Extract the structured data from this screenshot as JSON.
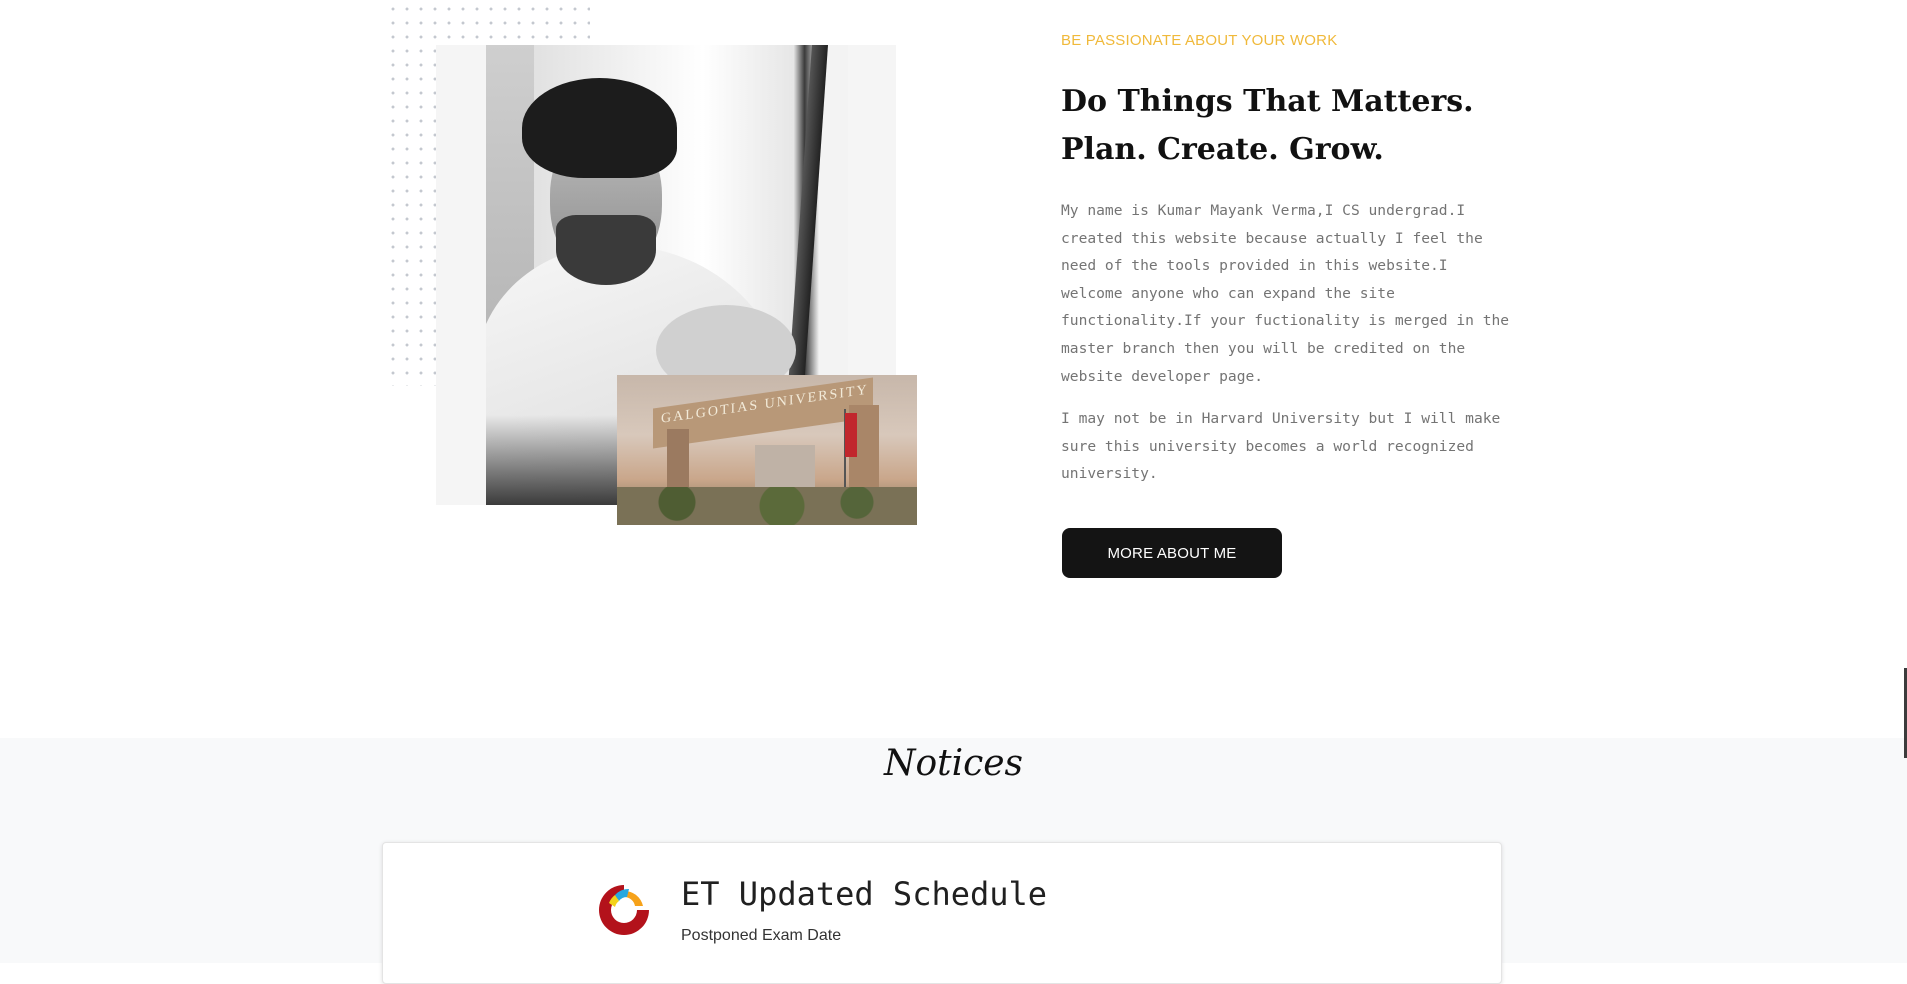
{
  "about": {
    "kicker": "BE PASSIONATE ABOUT YOUR WORK",
    "headline": "Do Things That Matters. Plan. Create. Grow.",
    "paragraph_1": "My name is Kumar Mayank Verma,I CS undergrad.I created this website because actually I feel the need of the tools provided in this website.I welcome anyone who can expand the site functionality.If your fuctionality is merged in the master branch then you will be credited on the website developer page.",
    "paragraph_2": "I may not be in Harvard University but I will make sure this university becomes a world recognized university.",
    "button_label": "MORE ABOUT ME",
    "gate_sign": "GALGOTIAS UNIVERSITY"
  },
  "notices": {
    "section_title": "Notices",
    "items": [
      {
        "title": "ET Updated Schedule",
        "subtitle": "Postponed Exam Date",
        "icon": "university-logo-icon"
      }
    ]
  },
  "colors": {
    "accent": "#f0b93a",
    "heading": "#111111",
    "body_text": "#747474",
    "button_bg": "#141414",
    "notices_bg": "#f8f9fa"
  }
}
